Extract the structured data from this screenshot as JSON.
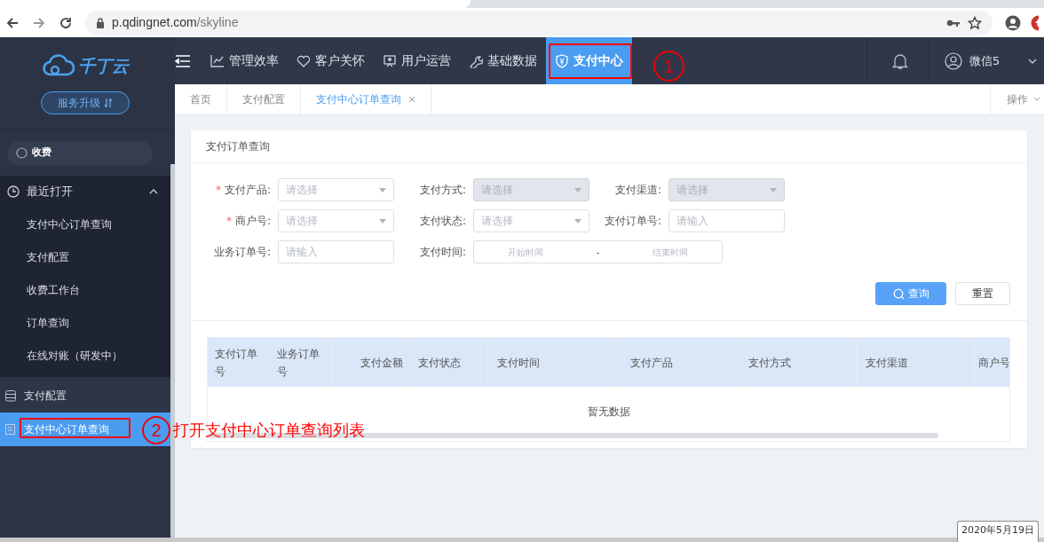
{
  "browser": {
    "url_host": "p.qdingnet.com",
    "url_path": "/skyline"
  },
  "logo": {
    "text": "千丁云"
  },
  "upgrade_button": {
    "label": "服务升级"
  },
  "sidebar": {
    "search": {
      "value": "收费"
    },
    "recent": {
      "label": "最近打开",
      "expanded": true,
      "items": [
        {
          "label": "支付中心订单查询"
        },
        {
          "label": "支付配置"
        },
        {
          "label": "收费工作台"
        },
        {
          "label": "订单查询"
        },
        {
          "label": "在线对账（研发中）"
        }
      ]
    },
    "items": [
      {
        "label": "支付配置",
        "selected": false
      },
      {
        "label": "支付中心订单查询",
        "selected": true
      }
    ]
  },
  "top_nav": {
    "items": [
      {
        "label": "管理效率",
        "selected": false
      },
      {
        "label": "客户关怀",
        "selected": false
      },
      {
        "label": "用户运营",
        "selected": false
      },
      {
        "label": "基础数据",
        "selected": false
      },
      {
        "label": "支付中心",
        "selected": true
      }
    ],
    "user": "微信5"
  },
  "tabs": [
    {
      "label": "首页",
      "selected": false,
      "closable": false
    },
    {
      "label": "支付配置",
      "selected": false,
      "closable": false
    },
    {
      "label": "支付中心订单查询",
      "selected": true,
      "closable": true
    }
  ],
  "tab_actions": "操作",
  "panel": {
    "title": "支付订单查询",
    "required_mark": "*",
    "form": [
      [
        {
          "label": "支付产品:",
          "required": true,
          "kind": "select",
          "placeholder": "请选择",
          "disabled": false
        },
        {
          "label": "支付方式:",
          "required": false,
          "kind": "select",
          "placeholder": "请选择",
          "disabled": true
        },
        {
          "label": "支付渠道:",
          "required": false,
          "kind": "select",
          "placeholder": "请选择",
          "disabled": true
        }
      ],
      [
        {
          "label": "商户号:",
          "required": true,
          "kind": "select",
          "placeholder": "请选择",
          "disabled": false
        },
        {
          "label": "支付状态:",
          "required": false,
          "kind": "select",
          "placeholder": "请选择",
          "disabled": false
        },
        {
          "label": "支付订单号:",
          "required": false,
          "kind": "input",
          "placeholder": "请输入",
          "disabled": false
        }
      ],
      [
        {
          "label": "业务订单号:",
          "required": false,
          "kind": "input",
          "placeholder": "请输入",
          "disabled": false
        },
        {
          "label": "支付时间:",
          "required": false,
          "kind": "daterange",
          "start_placeholder": "开始时间",
          "separator": "-",
          "end_placeholder": "结束时间",
          "disabled": false
        }
      ]
    ],
    "buttons": [
      {
        "label": "查询",
        "kind": "primary"
      },
      {
        "label": "重置",
        "kind": "default"
      }
    ],
    "table": {
      "columns": [
        "支付订单号",
        "业务订单号",
        "支付金额",
        "支付状态",
        "支付时间",
        "支付产品",
        "支付方式",
        "支付渠道",
        "商户号"
      ],
      "empty_text": "暂无数据"
    }
  },
  "annotations": [
    {
      "number": "1"
    },
    {
      "number": "2",
      "text": "打开支付中心订单查询列表"
    }
  ],
  "tooltip": "2020年5月19日"
}
